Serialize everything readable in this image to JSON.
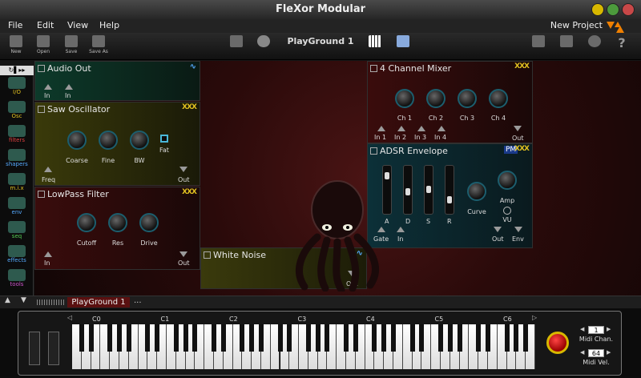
{
  "window": {
    "title": "FleXor Modular"
  },
  "menu": {
    "items": [
      "File",
      "Edit",
      "View",
      "Help"
    ],
    "project": "New Project"
  },
  "toolbar": {
    "new": "New",
    "open": "Open",
    "save": "Save",
    "save_as": "Save As",
    "playground": "PlayGround 1"
  },
  "sidebar": {
    "header": "↻▌▸▸",
    "tabs": [
      {
        "label": "I/O",
        "color": "#e0c020"
      },
      {
        "label": "Osc",
        "color": "#e0c020"
      },
      {
        "label": "filters",
        "color": "#e04040"
      },
      {
        "label": "shapers",
        "color": "#55aaff"
      },
      {
        "label": "m.i.x",
        "color": "#e0c020"
      },
      {
        "label": "env",
        "color": "#55aaff"
      },
      {
        "label": "seq",
        "color": "#55cc55"
      },
      {
        "label": "effects",
        "color": "#55aaff"
      },
      {
        "label": "tools",
        "color": "#cc55cc"
      }
    ]
  },
  "modules": {
    "audio_out": {
      "title": "Audio Out",
      "wave": "∿",
      "ports": [
        "In",
        "In"
      ]
    },
    "saw": {
      "title": "Saw Oscillator",
      "xxx": "XXX",
      "knobs": [
        "Coarse",
        "Fine",
        "BW"
      ],
      "fat": "Fat",
      "freq": "Freq",
      "out": "Out"
    },
    "lowpass": {
      "title": "LowPass Filter",
      "xxx": "XXX",
      "knobs": [
        "Cutoff",
        "Res",
        "Drive"
      ],
      "in": "In",
      "out": "Out"
    },
    "noise": {
      "title": "White Noise",
      "wave": "∿",
      "out": "Out"
    },
    "mixer": {
      "title": "4 Channel Mixer",
      "xxx": "XXX",
      "knobs": [
        "Ch 1",
        "Ch 2",
        "Ch 3",
        "Ch 4"
      ],
      "ins": [
        "In 1",
        "In 2",
        "In 3",
        "In 4"
      ],
      "out": "Out"
    },
    "adsr": {
      "title": "ADSR Envelope",
      "pm": "PM",
      "xxx": "XXX",
      "sliders": [
        "A",
        "D",
        "S",
        "R"
      ],
      "levels": [
        0.85,
        0.45,
        0.5,
        0.25
      ],
      "curve": "Curve",
      "amp": "Amp",
      "vu": "VU",
      "gate": "Gate",
      "in": "In",
      "out": "Out",
      "env": "Env"
    }
  },
  "bottom": {
    "tab": "PlayGround 1",
    "more": "..."
  },
  "piano": {
    "octaves": [
      "C0",
      "C1",
      "C2",
      "C3",
      "C4",
      "C5",
      "C6"
    ],
    "midi_chan_label": "Midi Chan.",
    "midi_chan": "1",
    "midi_vel_label": "Midi Vel.",
    "midi_vel": "64"
  },
  "colors": {
    "accent": "#e0c020",
    "module_teal": "#1c5e6e",
    "canvas": "#3a0e0e"
  }
}
